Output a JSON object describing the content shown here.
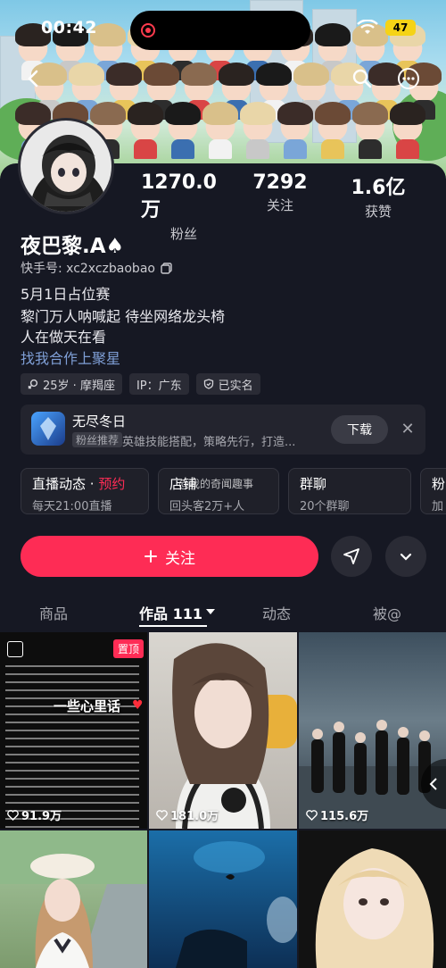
{
  "status": {
    "time": "00:42",
    "battery": "47"
  },
  "profile": {
    "name": "夜巴黎.A♠",
    "uid": "快手号: xc2xczbaobao",
    "bio": [
      "5月1日占位赛",
      "黎门万人呐喊起 待坐网络龙头椅",
      "人在做天在看"
    ],
    "business_link": "找我合作上聚星",
    "stats": [
      {
        "value": "1270.0万",
        "label": "粉丝"
      },
      {
        "value": "7292",
        "label": "关注"
      },
      {
        "value": "1.6亿",
        "label": "获赞"
      }
    ],
    "tags": [
      "25岁 · 摩羯座",
      "IP：广东",
      "已实名"
    ]
  },
  "ad": {
    "title": "无尽冬日",
    "badge": "粉丝推荐",
    "desc": "英雄技能搭配，策略先行，打造...",
    "download": "下载"
  },
  "cards": [
    {
      "title": "直播动态 · ",
      "accent": "预约",
      "sub": "每天21:00直播"
    },
    {
      "title": "店铺",
      "accent": "",
      "sub": "回头客2万+人"
    },
    {
      "title": "群聊",
      "accent": "",
      "sub": "20个群聊"
    },
    {
      "title": "粉",
      "accent": "",
      "sub": "加"
    }
  ],
  "watermark": "@我的奇闻趣事",
  "follow_label": "关注",
  "tabs": [
    "商品",
    "作品 111",
    "动态",
    "被@"
  ],
  "grid": [
    {
      "likes": "91.9万",
      "pinned": "置顶",
      "overlay": "一些心里话"
    },
    {
      "likes": "181.0万"
    },
    {
      "likes": "115.6万"
    },
    {},
    {},
    {}
  ],
  "colors": {
    "accent": "#fe2c55",
    "background": "#161823"
  }
}
